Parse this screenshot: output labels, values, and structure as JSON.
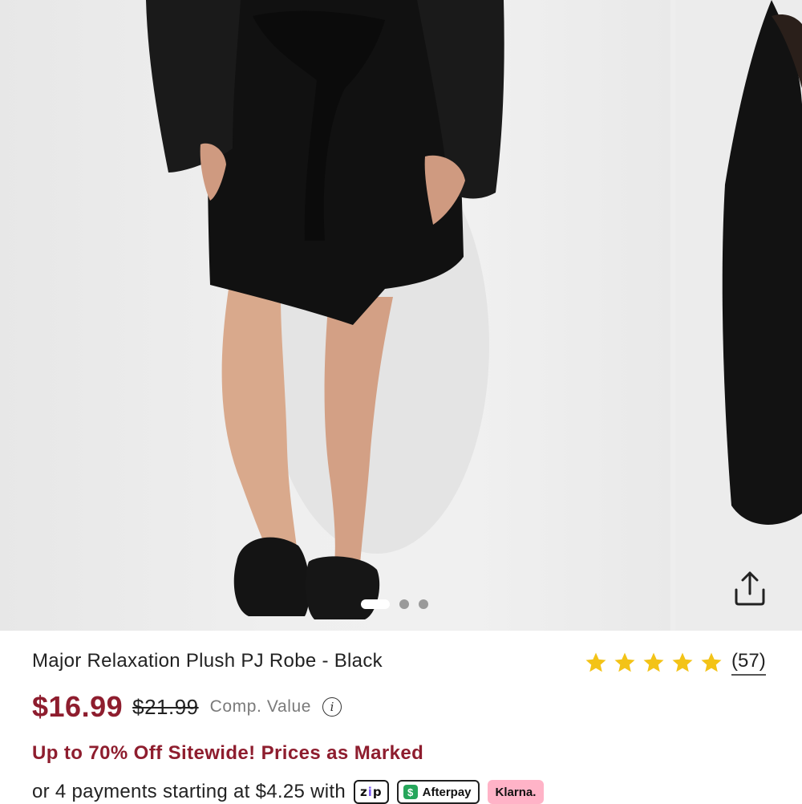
{
  "gallery": {
    "slide_count": 3,
    "active_slide": 1,
    "share_icon": "share-icon"
  },
  "product": {
    "title": "Major Relaxation Plush PJ Robe - Black",
    "rating": {
      "stars": 5,
      "review_count": "(57)",
      "star_color": "#f3c317"
    },
    "price": "$16.99",
    "compare_price": "$21.99",
    "compare_label": "Comp. Value",
    "info_icon": "info-icon",
    "info_glyph": "i",
    "promo": "Up to 70% Off Sitewide! Prices as Marked",
    "payments_text": "or 4 payments starting at $4.25 with",
    "payment_badges": {
      "zip_prefix": "z",
      "zip_mid": "i",
      "zip_suffix": "p",
      "afterpay_glyph": "$",
      "afterpay": "Afterpay",
      "klarna": "Klarna."
    }
  },
  "colors": {
    "price_red": "#8e1d2e",
    "promo_red": "#8e1d2e",
    "klarna_pink": "#ffb3c7",
    "afterpay_green": "#26a65b"
  }
}
